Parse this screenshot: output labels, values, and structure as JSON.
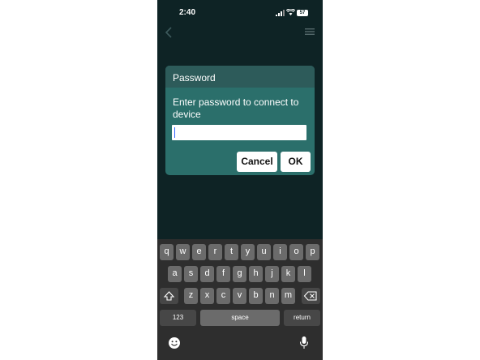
{
  "status_bar": {
    "time": "2:40",
    "battery": "57"
  },
  "dialog": {
    "title": "Password",
    "message": "Enter password to connect to device",
    "input_value": "",
    "cancel_label": "Cancel",
    "ok_label": "OK"
  },
  "keyboard": {
    "row1": [
      "q",
      "w",
      "e",
      "r",
      "t",
      "y",
      "u",
      "i",
      "o",
      "p"
    ],
    "row2": [
      "a",
      "s",
      "d",
      "f",
      "g",
      "h",
      "j",
      "k",
      "l"
    ],
    "row3": [
      "z",
      "x",
      "c",
      "v",
      "b",
      "n",
      "m"
    ],
    "numbers_label": "123",
    "space_label": "space",
    "return_label": "return"
  },
  "colors": {
    "background": "#0e2325",
    "dialog": "#2b6f6b",
    "dialog_title_bar": "#2d5b5a",
    "keyboard": "#2e2e2e"
  },
  "icons": [
    "back-icon",
    "menu-icon",
    "signal-icon",
    "wifi-icon",
    "battery-icon",
    "shift-icon",
    "backspace-icon",
    "emoji-icon",
    "microphone-icon"
  ]
}
